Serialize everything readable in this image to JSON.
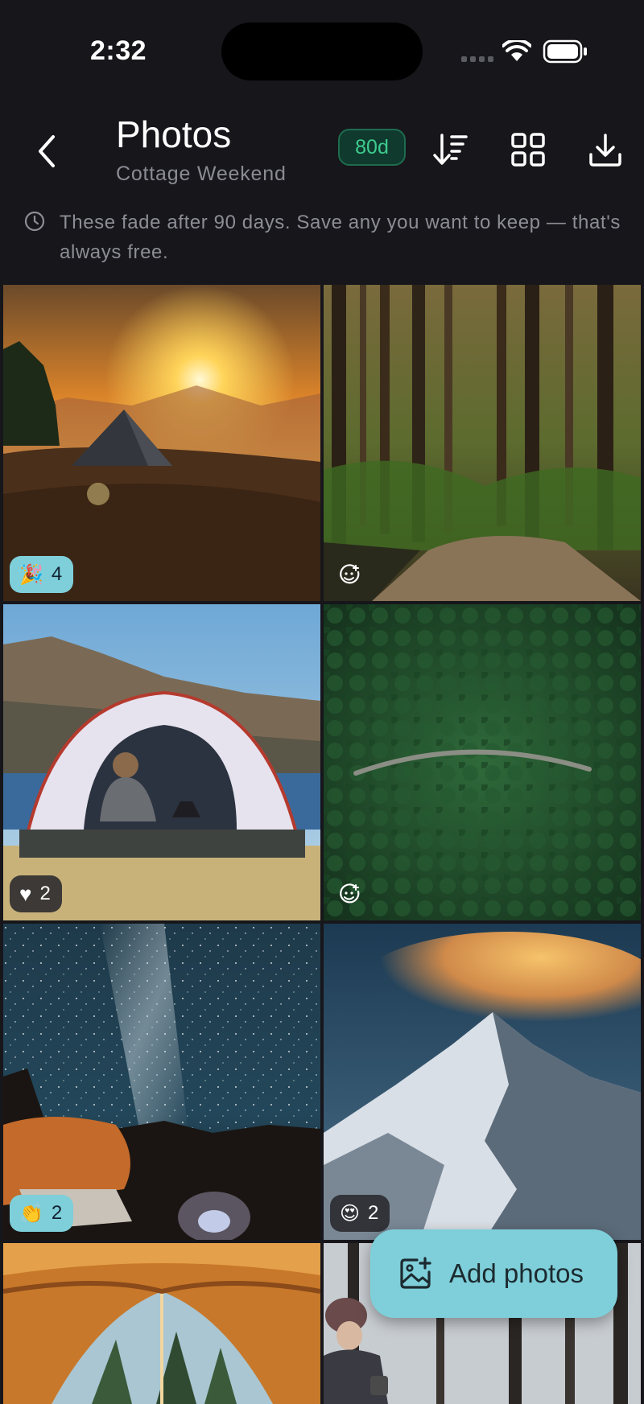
{
  "status_bar": {
    "time": "2:32"
  },
  "header": {
    "title": "Photos",
    "subtitle": "Cottage Weekend",
    "days_badge": "80d",
    "back_icon": "chevron-left-icon",
    "sort_icon": "sort-descending-icon",
    "grid_icon": "grid-view-icon",
    "download_icon": "download-icon"
  },
  "notice": {
    "icon": "clock-icon",
    "text": "These fade after 90 days. Save any you want to keep — that's always free."
  },
  "photos": [
    {
      "subject": "tent at sunset on mountain",
      "reaction": {
        "emoji": "🎉",
        "count": "4",
        "style": "cyan"
      }
    },
    {
      "subject": "forest trail",
      "reaction": null
    },
    {
      "subject": "dome tent by lake with person and dog",
      "reaction": {
        "emoji": "♥",
        "count": "2",
        "style": "dark"
      }
    },
    {
      "subject": "aerial forest with winding road",
      "reaction": null
    },
    {
      "subject": "milky way over campsite",
      "reaction": {
        "emoji": "👏",
        "count": "2",
        "style": "cyan"
      }
    },
    {
      "subject": "snowy mountain peak with glowing clouds",
      "reaction": {
        "emoji": "😍",
        "count": "2",
        "style": "dark"
      }
    },
    {
      "subject": "view out of tent into forest",
      "reaction": null
    },
    {
      "subject": "person in winter forest",
      "reaction": null
    }
  ],
  "fab": {
    "label": "Add photos",
    "icon": "add-photo-icon"
  },
  "colors": {
    "accent": "#7ecfd9",
    "badge_green": "#3ecb8f",
    "background": "#16161b"
  }
}
